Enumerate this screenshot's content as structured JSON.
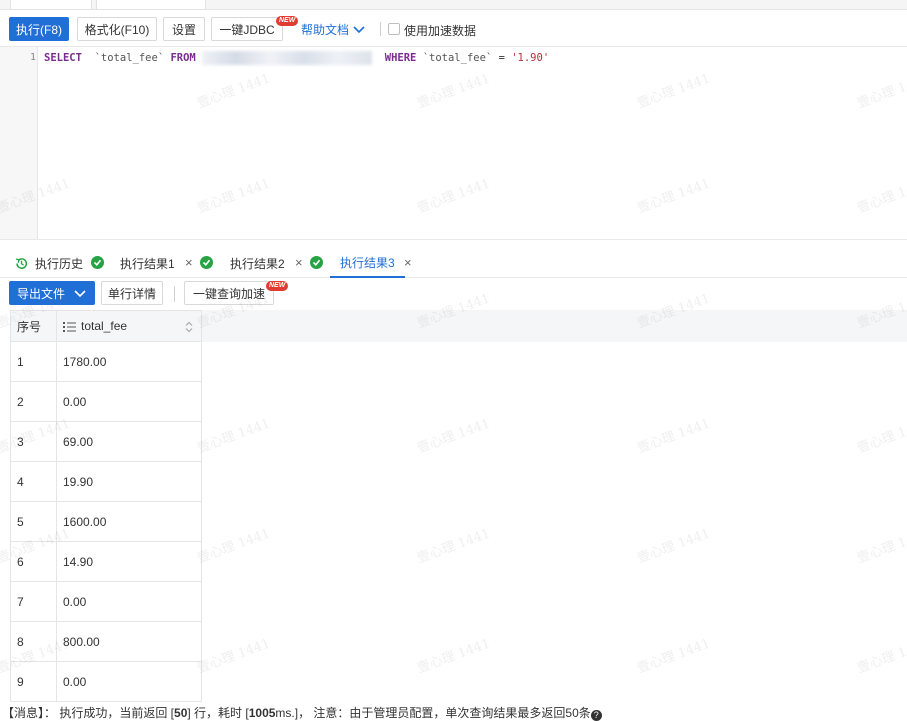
{
  "toolbar": {
    "execute_label": "执行(F8)",
    "format_label": "格式化(F10)",
    "settings_label": "设置",
    "jdbc_label": "一键JDBC",
    "new_badge": "NEW",
    "help_label": "帮助文档",
    "accelerate_label": "使用加速数据"
  },
  "editor": {
    "line_number": "1",
    "kw_select": "SELECT",
    "col_name": "`total_fee`",
    "kw_from": "FROM",
    "kw_where": "WHERE",
    "where_col": "`total_fee`",
    "operator": "=",
    "value": "'1.90'"
  },
  "result_tabs": {
    "history_label": "执行历史",
    "tabs": [
      {
        "label": "执行结果1"
      },
      {
        "label": "执行结果2"
      },
      {
        "label": "执行结果3"
      }
    ],
    "close": "×"
  },
  "result_toolbar": {
    "export_label": "导出文件",
    "row_detail_label": "单行详情",
    "query_accel_label": "一键查询加速",
    "new_badge": "NEW"
  },
  "table": {
    "columns": [
      "序号",
      "total_fee"
    ],
    "rows": [
      {
        "idx": "1",
        "total_fee": "1780.00"
      },
      {
        "idx": "2",
        "total_fee": "0.00"
      },
      {
        "idx": "3",
        "total_fee": "69.00"
      },
      {
        "idx": "4",
        "total_fee": "19.90"
      },
      {
        "idx": "5",
        "total_fee": "1600.00"
      },
      {
        "idx": "6",
        "total_fee": "14.90"
      },
      {
        "idx": "7",
        "total_fee": "0.00"
      },
      {
        "idx": "8",
        "total_fee": "800.00"
      },
      {
        "idx": "9",
        "total_fee": "0.00"
      }
    ]
  },
  "status": {
    "prefix": "【消息】：  执行成功，当前返回 [",
    "count": "50",
    "mid1": "] 行，耗时 [",
    "time": "1005",
    "mid2": "ms.]，  注意：由于管理员配置，单次查询结果最多返回50条",
    "help": "?"
  },
  "watermark": "壹心理 1441",
  "colors": {
    "primary": "#1f6fd6",
    "success": "#27a345",
    "badge": "#e03c31",
    "keyword": "#7c2b91",
    "string": "#b0333c"
  }
}
